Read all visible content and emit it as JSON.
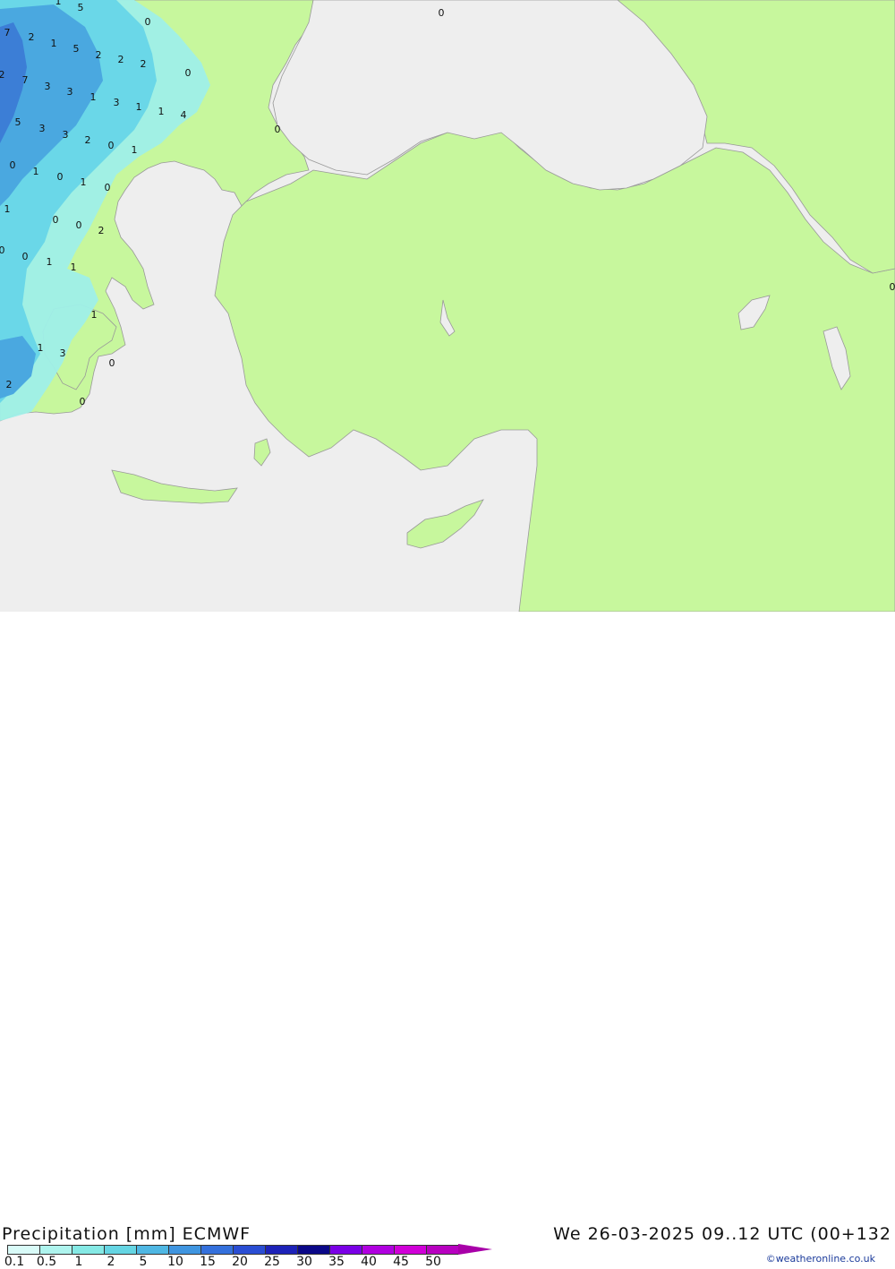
{
  "map": {
    "colors": {
      "sea": "#eeeeee",
      "land": "#c7f79d",
      "border": "#999999",
      "precip_light": "#9fefe8",
      "precip_mid": "#6ad7e8",
      "precip_heavy": "#4aa8e0",
      "precip_strong": "#3c7ed6"
    },
    "labels": [
      "1",
      "5",
      "0",
      "7",
      "2",
      "1",
      "5",
      "2",
      "2",
      "2",
      "0",
      "2",
      "7",
      "3",
      "3",
      "1",
      "3",
      "1",
      "1",
      "4",
      "5",
      "3",
      "3",
      "2",
      "0",
      "1",
      "0",
      "1",
      "0",
      "1",
      "0",
      "0",
      "1",
      "0",
      "0",
      "2",
      "0",
      "0",
      "1",
      "1",
      "1",
      "1",
      "3",
      "0",
      "2",
      "0",
      "0",
      "0",
      "0"
    ]
  },
  "legend": {
    "title_left": "Precipitation [mm] ECMWF",
    "title_right": "We 26-03-2025 09..12 UTC (00+132",
    "scale": [
      {
        "label": "0.1",
        "color": "#d9fbf8"
      },
      {
        "label": "0.5",
        "color": "#aef4ee"
      },
      {
        "label": "1",
        "color": "#85e9e5"
      },
      {
        "label": "2",
        "color": "#65d5e3"
      },
      {
        "label": "5",
        "color": "#4fb7e3"
      },
      {
        "label": "10",
        "color": "#3f95e0"
      },
      {
        "label": "15",
        "color": "#3470dc"
      },
      {
        "label": "20",
        "color": "#2a4dd3"
      },
      {
        "label": "25",
        "color": "#1d22b8"
      },
      {
        "label": "30",
        "color": "#0b0888"
      },
      {
        "label": "35",
        "color": "#7a00e6"
      },
      {
        "label": "40",
        "color": "#b000e0"
      },
      {
        "label": "45",
        "color": "#d000d8"
      },
      {
        "label": "50",
        "color": "#b800c0"
      }
    ],
    "credit": "©weatheronline.co.uk"
  }
}
